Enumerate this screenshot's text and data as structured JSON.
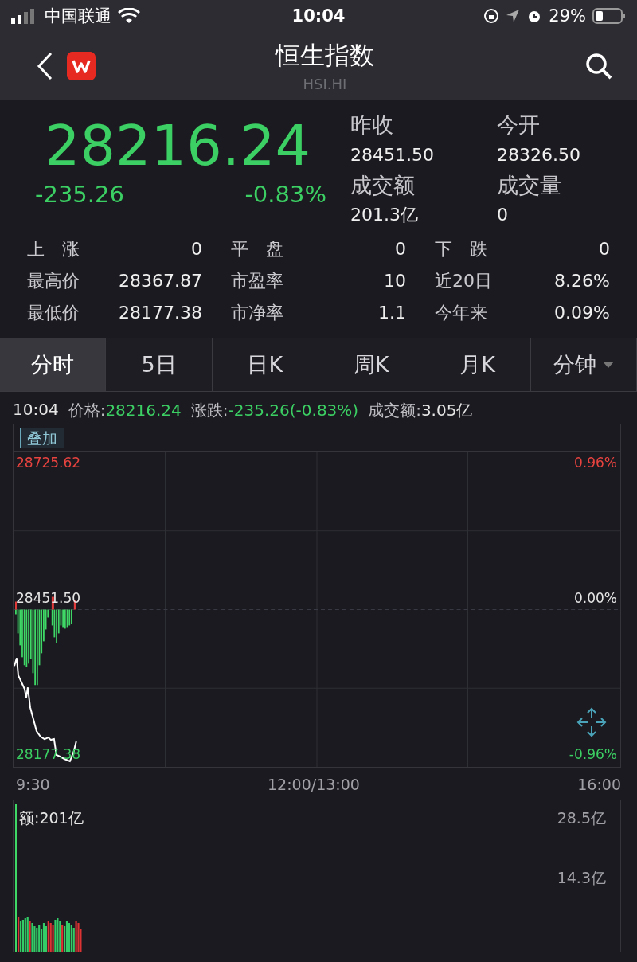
{
  "status_bar": {
    "carrier": "中国联通",
    "time": "10:04",
    "battery": "29%"
  },
  "header": {
    "title": "恒生指数",
    "subtitle": "HSI.HI"
  },
  "quote": {
    "price": "28216.24",
    "change": "-235.26",
    "change_pct": "-0.83%",
    "color": "#3ccf63",
    "fields": [
      {
        "label": "昨收",
        "value": "28451.50"
      },
      {
        "label": "今开",
        "value": "28326.50"
      },
      {
        "label": "成交额",
        "value": "201.3亿"
      },
      {
        "label": "成交量",
        "value": "0"
      }
    ]
  },
  "stats": [
    {
      "label": "上　涨",
      "value": "0"
    },
    {
      "label": "平　盘",
      "value": "0"
    },
    {
      "label": "下　跌",
      "value": "0"
    },
    {
      "label": "最高价",
      "value": "28367.87"
    },
    {
      "label": "市盈率",
      "value": "10"
    },
    {
      "label": "近20日",
      "value": "8.26%"
    },
    {
      "label": "最低价",
      "value": "28177.38"
    },
    {
      "label": "市净率",
      "value": "1.1"
    },
    {
      "label": "今年来",
      "value": "0.09%"
    }
  ],
  "tabs": [
    {
      "label": "分时",
      "selected": true,
      "dropdown": false
    },
    {
      "label": "5日",
      "selected": false,
      "dropdown": false
    },
    {
      "label": "日K",
      "selected": false,
      "dropdown": false
    },
    {
      "label": "周K",
      "selected": false,
      "dropdown": false
    },
    {
      "label": "月K",
      "selected": false,
      "dropdown": false
    },
    {
      "label": "分钟",
      "selected": false,
      "dropdown": true
    }
  ],
  "info": {
    "time": "10:04",
    "items": [
      {
        "label": "价格:",
        "value": "28216.24",
        "color": "#3ccf63"
      },
      {
        "label": "涨跌:",
        "value": "-235.26(-0.83%)",
        "color": "#3ccf63"
      },
      {
        "label": "成交额:",
        "value": "3.05亿",
        "color": "#e6e6e6"
      }
    ]
  },
  "chart": {
    "overlay_button": "叠加",
    "left_labels": [
      {
        "text": "28725.62",
        "color": "#e8433f"
      },
      {
        "text": "28451.50",
        "color": "#e6e6e6"
      },
      {
        "text": "28177.38",
        "color": "#3ccf63"
      }
    ],
    "right_labels": [
      {
        "text": "0.96%",
        "color": "#e8433f"
      },
      {
        "text": "0.00%",
        "color": "#e6e6e6"
      },
      {
        "text": "-0.96%",
        "color": "#3ccf63"
      }
    ],
    "x_labels": [
      "9:30",
      "12:00/13:00",
      "16:00"
    ]
  },
  "volume": {
    "label": "额:201亿",
    "axis": [
      "28.5亿",
      "14.3亿"
    ]
  }
}
